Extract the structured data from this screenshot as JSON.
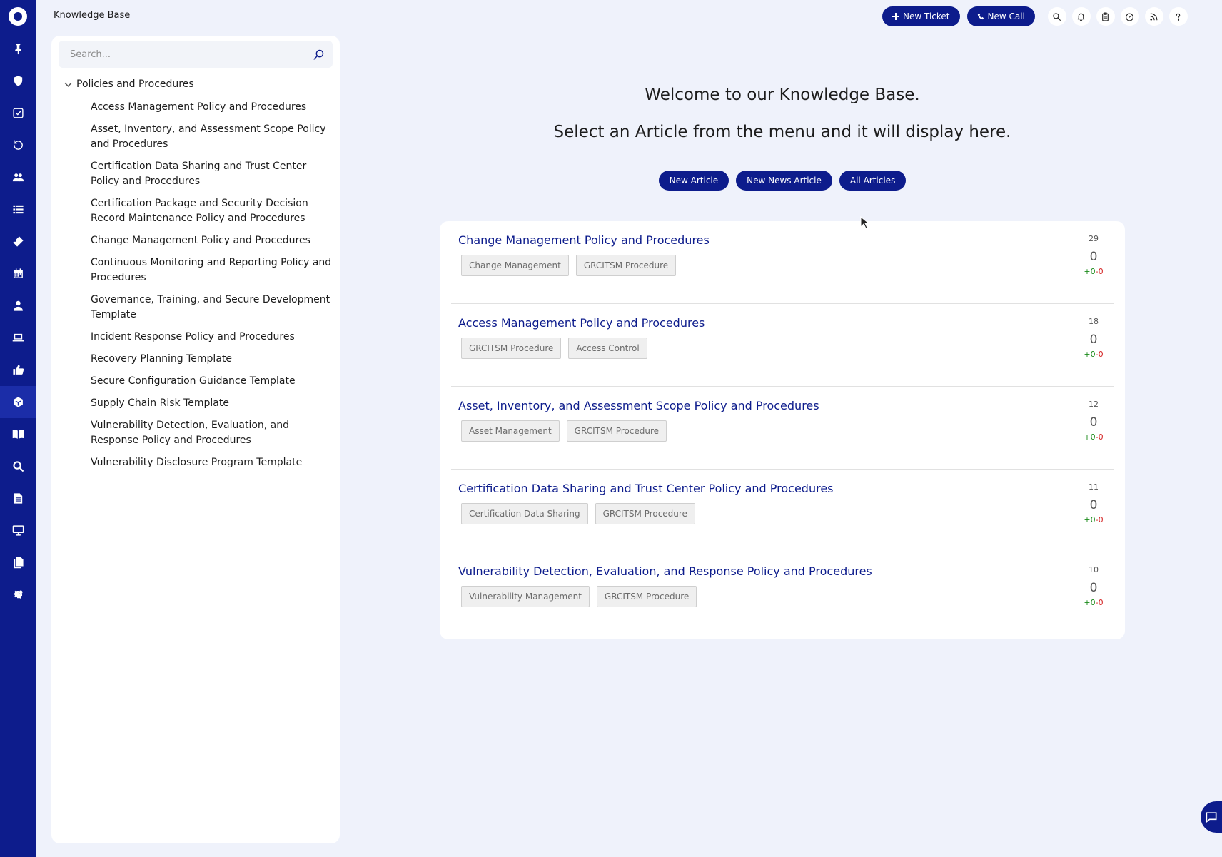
{
  "app": {
    "title": "Knowledge Base"
  },
  "rail": {
    "items": [
      {
        "icon": "pin-icon"
      },
      {
        "icon": "shield-icon"
      },
      {
        "icon": "checkbox-icon"
      },
      {
        "icon": "history-icon"
      },
      {
        "icon": "users-icon"
      },
      {
        "icon": "list-icon"
      },
      {
        "icon": "ticket-icon"
      },
      {
        "icon": "calendar-icon"
      },
      {
        "icon": "person-icon"
      },
      {
        "icon": "laptop-icon"
      },
      {
        "icon": "thumbs-up-icon"
      },
      {
        "icon": "knowledge-base-icon",
        "active": true
      },
      {
        "icon": "book-icon"
      },
      {
        "icon": "search-icon"
      },
      {
        "icon": "document-icon"
      },
      {
        "icon": "monitor-icon"
      },
      {
        "icon": "files-icon"
      },
      {
        "icon": "settings-icon"
      }
    ]
  },
  "topbar": {
    "new_ticket": "New Ticket",
    "new_call": "New Call",
    "icons": [
      "search-icon",
      "bell-icon",
      "clipboard-icon",
      "dashboard-icon",
      "rss-icon",
      "help-icon"
    ]
  },
  "sidebar": {
    "search_placeholder": "Search...",
    "root": "Policies and Procedures",
    "items": [
      "Access Management Policy and Procedures",
      "Asset, Inventory, and Assessment Scope Policy and Procedures",
      "Certification Data Sharing and Trust Center Policy and Procedures",
      "Certification Package and Security Decision Record Maintenance Policy and Procedures",
      "Change Management Policy and Procedures",
      "Continuous Monitoring and Reporting Policy and Procedures",
      "Governance, Training, and Secure Development Template",
      "Incident Response Policy and Procedures",
      "Recovery Planning Template",
      "Secure Configuration Guidance Template",
      "Supply Chain Risk Template",
      "Vulnerability Detection, Evaluation, and Response Policy and Procedures",
      "Vulnerability Disclosure Program Template"
    ]
  },
  "main": {
    "welcome": "Welcome to our Knowledge Base.",
    "instruction": "Select an Article from the menu and it will display here.",
    "buttons": {
      "new_article": "New Article",
      "new_news_article": "New News Article",
      "all_articles": "All Articles"
    },
    "articles": [
      {
        "title": "Change Management Policy and Procedures",
        "tags": [
          "Change Management",
          "GRCITSM Procedure"
        ],
        "views": "29",
        "score": "0",
        "up": "+0",
        "sep": "-",
        "down": "0"
      },
      {
        "title": "Access Management Policy and Procedures",
        "tags": [
          "GRCITSM Procedure",
          "Access Control"
        ],
        "views": "18",
        "score": "0",
        "up": "+0",
        "sep": "-",
        "down": "0"
      },
      {
        "title": "Asset, Inventory, and Assessment Scope Policy and Procedures",
        "tags": [
          "Asset Management",
          "GRCITSM Procedure"
        ],
        "views": "12",
        "score": "0",
        "up": "+0",
        "sep": "-",
        "down": "0"
      },
      {
        "title": "Certification Data Sharing and Trust Center Policy and Procedures",
        "tags": [
          "Certification Data Sharing",
          "GRCITSM Procedure"
        ],
        "views": "11",
        "score": "0",
        "up": "+0",
        "sep": "-",
        "down": "0"
      },
      {
        "title": "Vulnerability Detection, Evaluation, and Response Policy and Procedures",
        "tags": [
          "Vulnerability Management",
          "GRCITSM Procedure"
        ],
        "views": "10",
        "score": "0",
        "up": "+0",
        "sep": "-",
        "down": "0"
      }
    ]
  },
  "colors": {
    "primary": "#0d1c8c",
    "background": "#eff2fb",
    "vote_up": "#1a8a1a",
    "vote_down": "#d42020"
  }
}
